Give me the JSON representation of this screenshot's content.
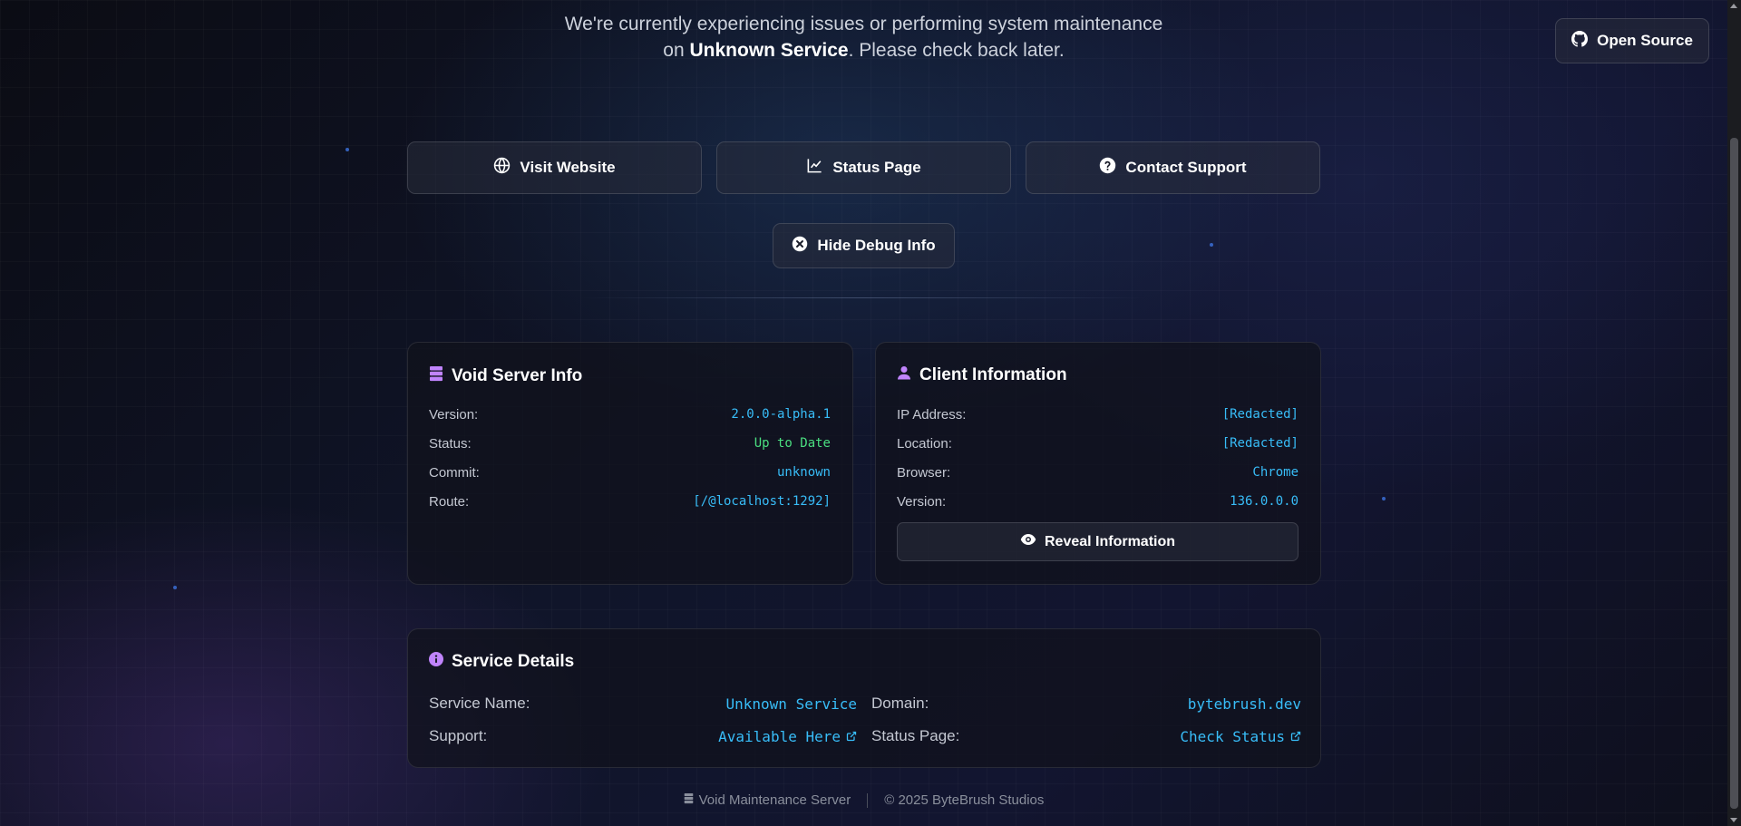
{
  "header": {
    "message_prefix": "We're currently experiencing issues or performing system maintenance on ",
    "service_name": "Unknown Service",
    "message_suffix": ". Please check back later.",
    "open_source_label": "Open Source"
  },
  "nav_buttons": {
    "visit_website": "Visit Website",
    "status_page": "Status Page",
    "contact_support": "Contact Support"
  },
  "debug_toggle_label": "Hide Debug Info",
  "server_info": {
    "title": "Void Server Info",
    "rows": [
      {
        "label": "Version:",
        "value": "2.0.0-alpha.1"
      },
      {
        "label": "Status:",
        "value": "Up to Date"
      },
      {
        "label": "Commit:",
        "value": "unknown"
      },
      {
        "label": "Route:",
        "value": "[/@localhost:1292]"
      }
    ]
  },
  "client_info": {
    "title": "Client Information",
    "rows": [
      {
        "label": "IP Address:",
        "value": "[Redacted]"
      },
      {
        "label": "Location:",
        "value": "[Redacted]"
      },
      {
        "label": "Browser:",
        "value": "Chrome"
      },
      {
        "label": "Version:",
        "value": "136.0.0.0"
      }
    ],
    "reveal_label": "Reveal Information"
  },
  "service_details": {
    "title": "Service Details",
    "service_name_label": "Service Name:",
    "service_name_value": "Unknown Service",
    "domain_label": "Domain:",
    "domain_value": "bytebrush.dev",
    "support_label": "Support:",
    "support_value": "Available Here",
    "status_page_label": "Status Page:",
    "status_page_value": "Check Status"
  },
  "footer": {
    "server_name": "Void Maintenance Server",
    "copyright": "© 2025 ByteBrush Studios"
  },
  "colors": {
    "accent_cyan": "#38bdf8",
    "status_green": "#4ade80",
    "icon_purple": "#c084fc"
  }
}
